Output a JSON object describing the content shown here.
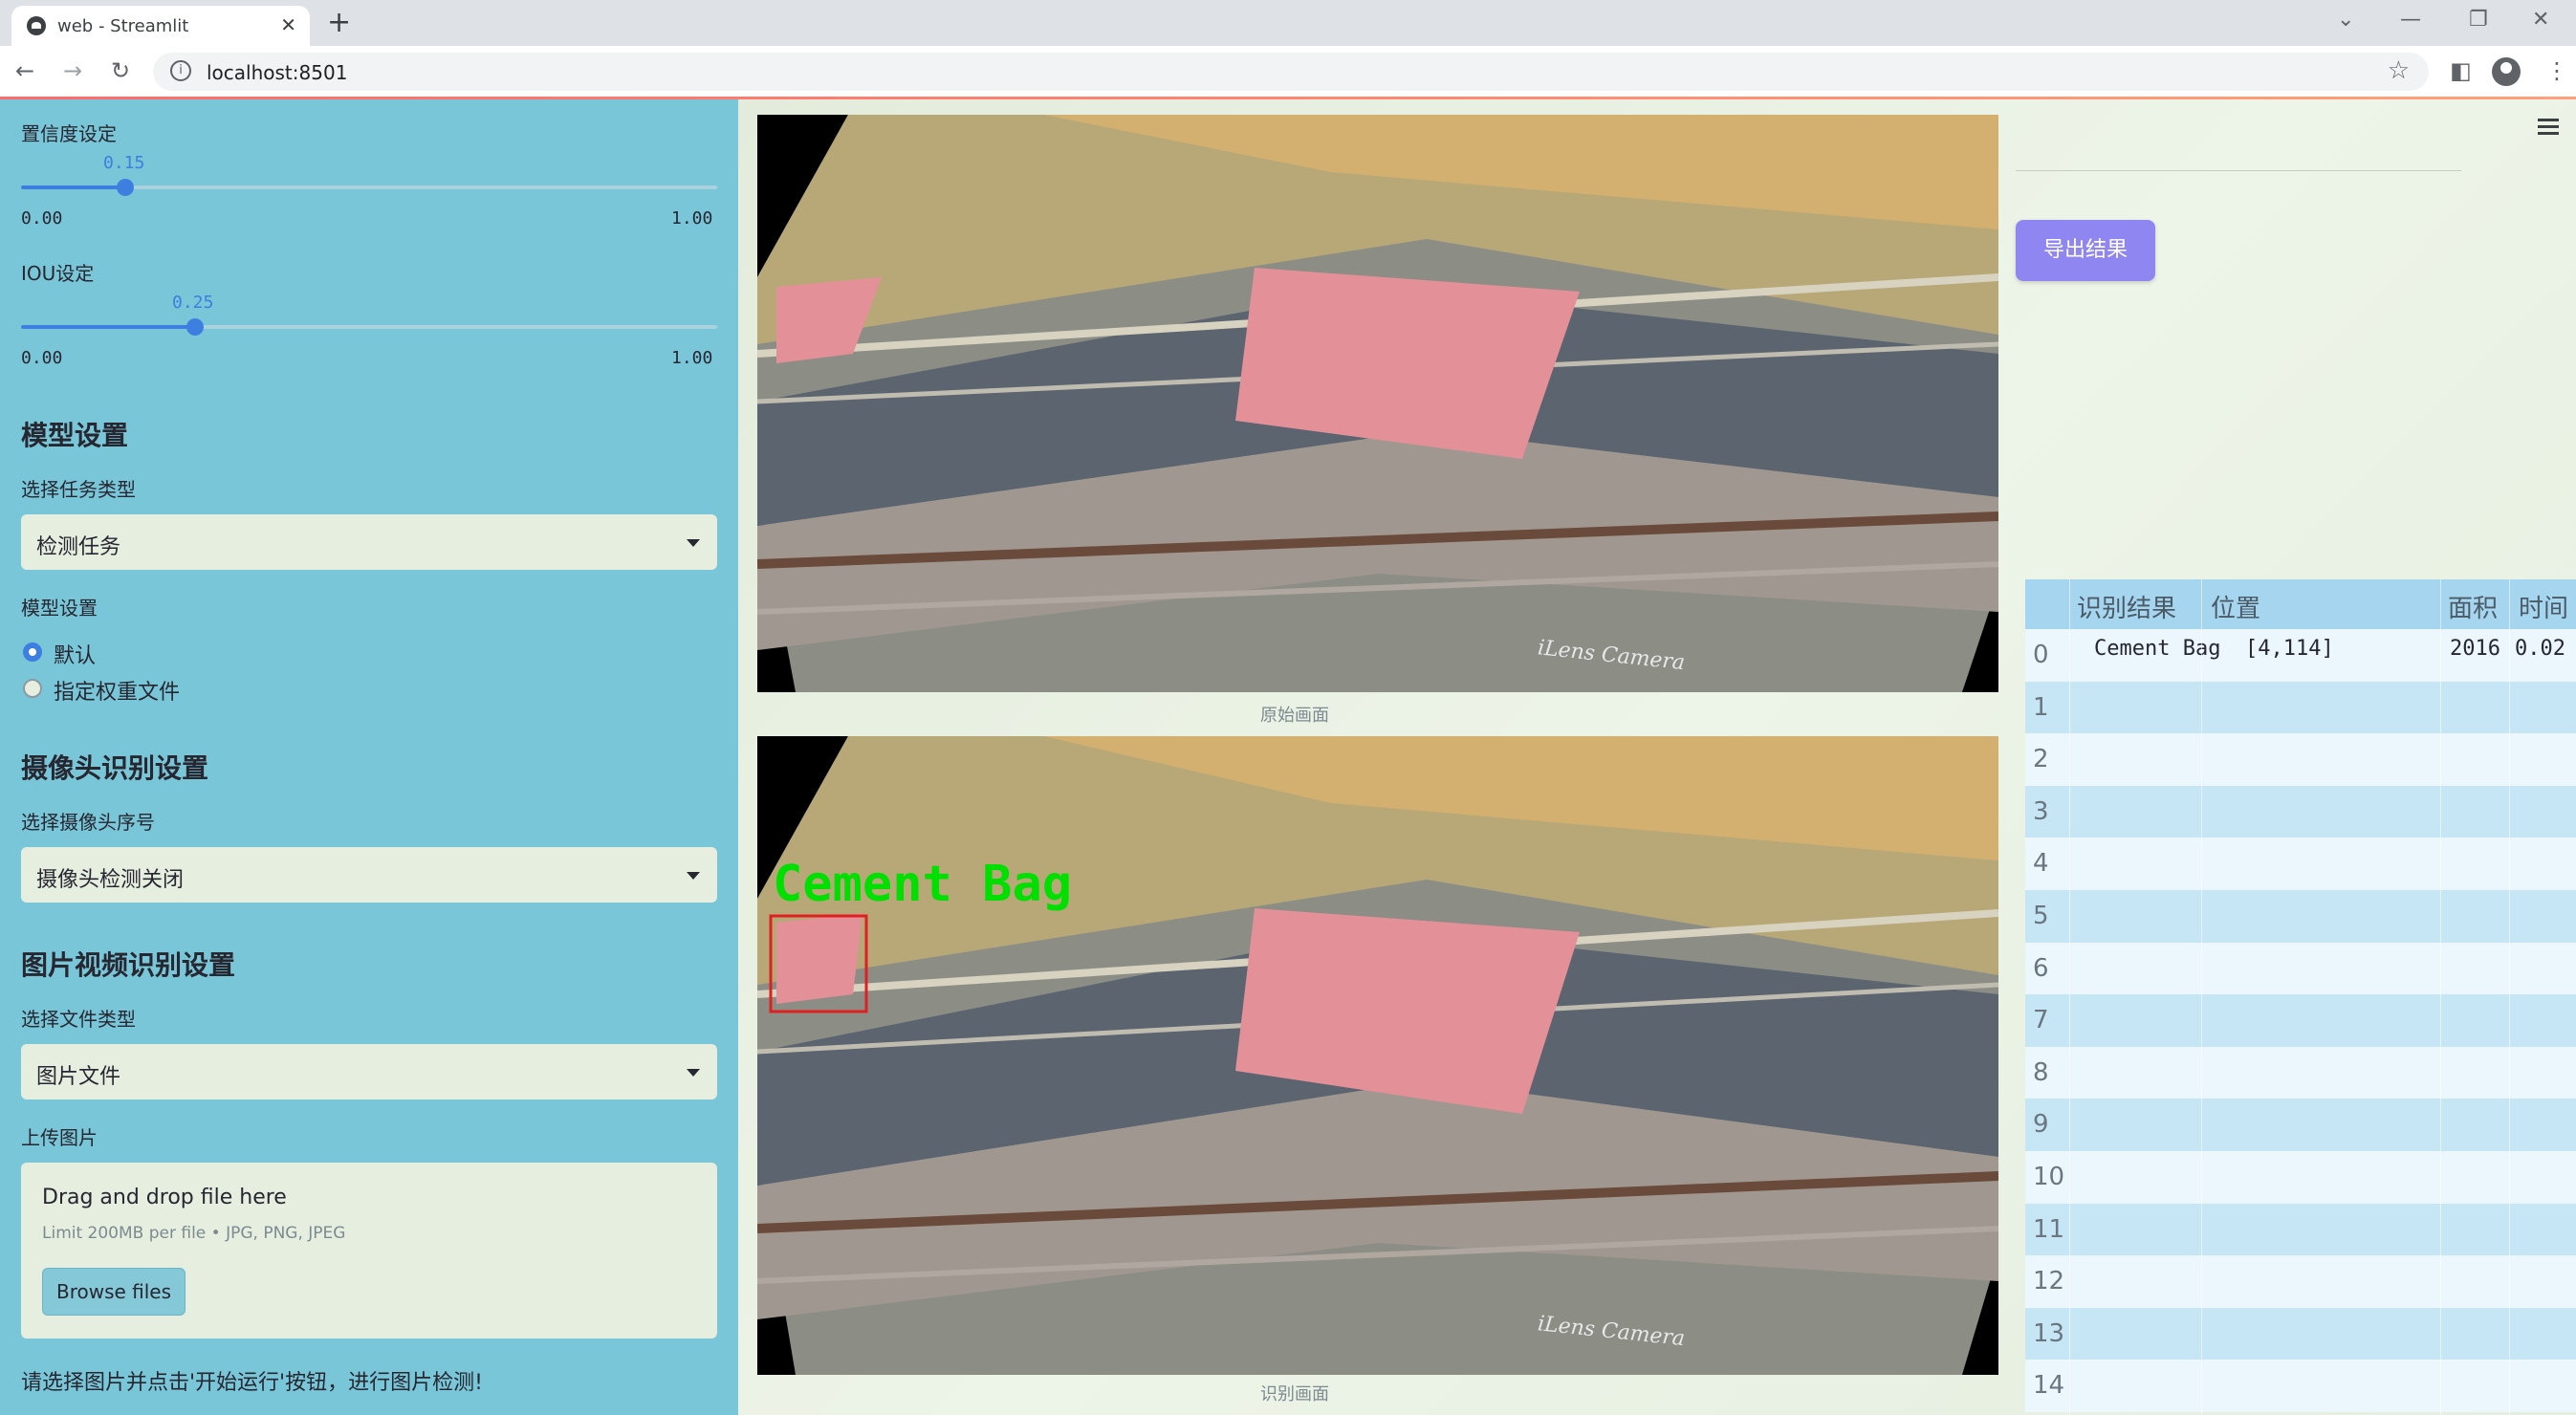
{
  "browser": {
    "tab_title": "web - Streamlit",
    "tab_close": "✕",
    "new_tab": "+",
    "url": "localhost:8501",
    "win_min": "—",
    "win_max": "❐",
    "win_close": "✕",
    "win_chevron": "⌄"
  },
  "sidebar": {
    "confidence": {
      "label": "置信度设定",
      "value": "0.15",
      "min": "0.00",
      "max": "1.00",
      "fraction": 0.15
    },
    "iou": {
      "label": "IOU设定",
      "value": "0.25",
      "min": "0.00",
      "max": "1.00",
      "fraction": 0.25
    },
    "model_section": "模型设置",
    "task_label": "选择任务类型",
    "task_value": "检测任务",
    "model_label": "模型设置",
    "model_options": [
      "默认",
      "指定权重文件"
    ],
    "model_selected": 0,
    "camera_section": "摄像头识别设置",
    "camera_label": "选择摄像头序号",
    "camera_value": "摄像头检测关闭",
    "file_section": "图片视频识别设置",
    "filetype_label": "选择文件类型",
    "filetype_value": "图片文件",
    "upload_label": "上传图片",
    "upload_drop": "Drag and drop file here",
    "upload_limit": "Limit 200MB per file • JPG, PNG, JPEG",
    "browse_button": "Browse files",
    "hint": "请选择图片并点击'开始运行'按钮，进行图片检测!"
  },
  "main": {
    "original_caption": "原始画面",
    "detected_caption": "识别画面",
    "watermark": "iLens Camera",
    "detection_label": "Cement Bag",
    "export_button": "导出结果"
  },
  "results_table": {
    "columns": [
      "识别结果",
      "位置",
      "面积",
      "时间"
    ],
    "rows": [
      {
        "index": "0",
        "result": "Cement Bag",
        "position": "[4,114]",
        "area": "2016",
        "time": "0.02"
      },
      {
        "index": "1"
      },
      {
        "index": "2"
      },
      {
        "index": "3"
      },
      {
        "index": "4"
      },
      {
        "index": "5"
      },
      {
        "index": "6"
      },
      {
        "index": "7"
      },
      {
        "index": "8"
      },
      {
        "index": "9"
      },
      {
        "index": "10"
      },
      {
        "index": "11"
      },
      {
        "index": "12"
      },
      {
        "index": "13"
      },
      {
        "index": "14"
      }
    ]
  },
  "colors": {
    "sidebar_bg": "#7ac6d9",
    "accent": "#3d7fe0",
    "export_button": "#8f86f2",
    "detect_text": "#00e000",
    "detect_box": "#e02020"
  }
}
